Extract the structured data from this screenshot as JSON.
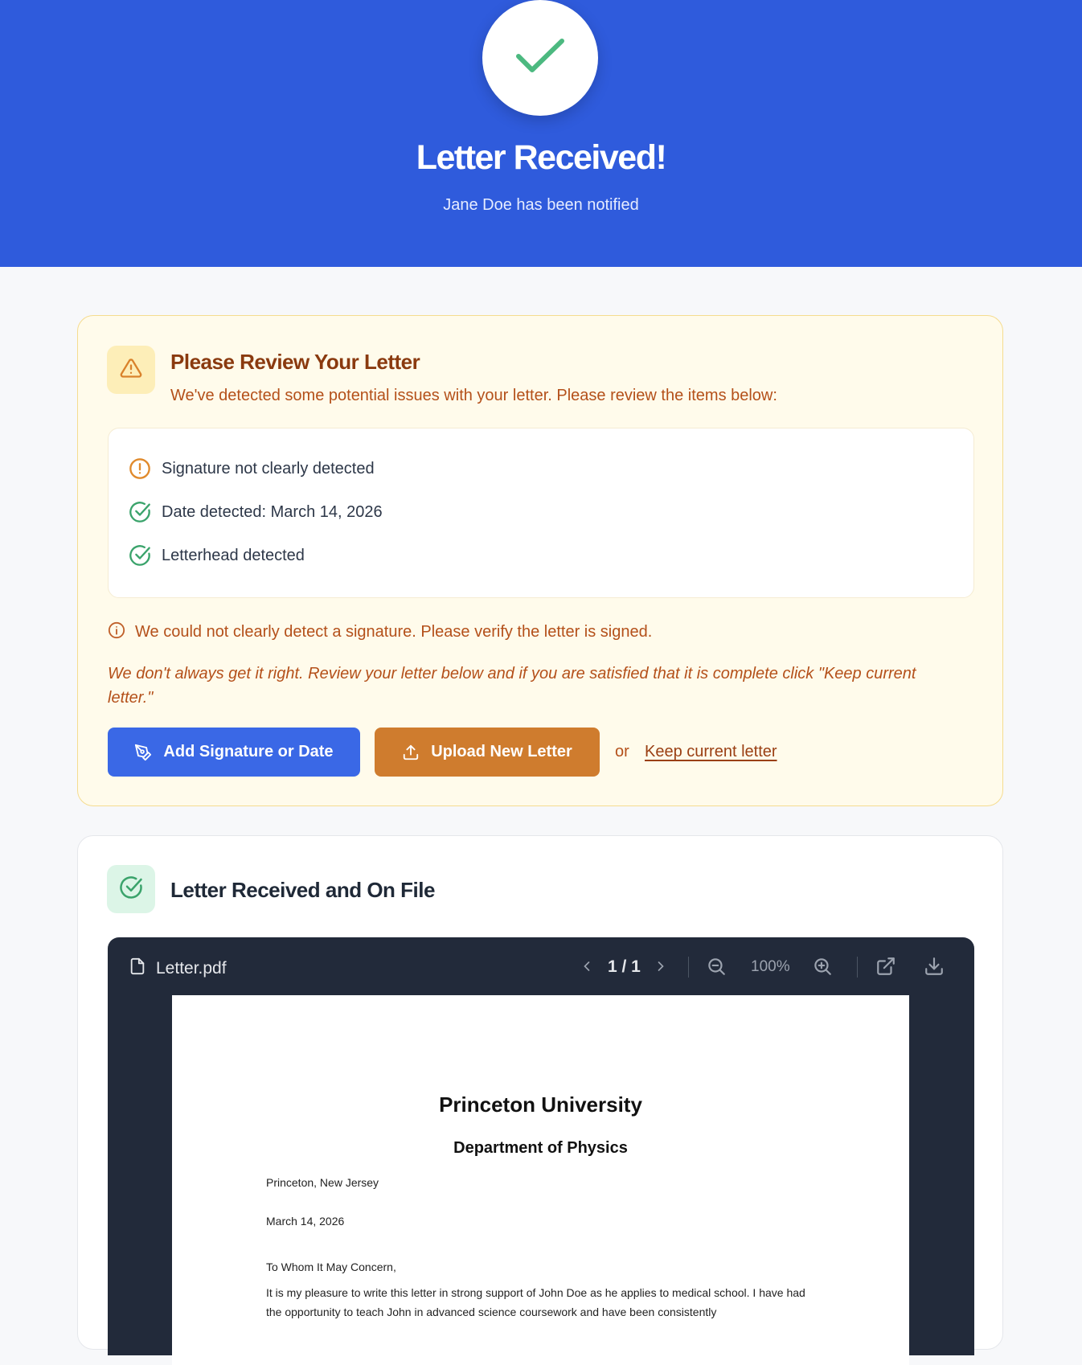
{
  "header": {
    "title": "Letter Received!",
    "subtitle": "Jane Doe has been notified",
    "icon": "check-icon",
    "accent": "#2f5bdc"
  },
  "review": {
    "title": "Please Review Your Letter",
    "description": "We've detected some potential issues with your letter. Please review the items below:",
    "checks": [
      {
        "label": "Signature not clearly detected",
        "status": "warning",
        "icon": "exclamation-circle-icon"
      },
      {
        "label": "Date detected: March 14, 2026",
        "status": "ok",
        "icon": "check-circle-icon"
      },
      {
        "label": "Letterhead detected",
        "status": "ok",
        "icon": "check-circle-icon"
      }
    ],
    "notice": "We could not clearly detect a signature. Please verify the letter is signed.",
    "disclaimer": "We don't always get it right. Review your letter below and if you are satisfied that it is complete click \"Keep current letter.\"",
    "add_signature_label": "Add Signature or Date",
    "upload_label": "Upload New Letter",
    "or_text": "or",
    "keep_label": "Keep current letter"
  },
  "on_file": {
    "title": "Letter Received and On File",
    "viewer": {
      "filename": "Letter.pdf",
      "page_indicator": "1 / 1",
      "zoom": "100%"
    },
    "document": {
      "university": "Princeton University",
      "department": "Department of Physics",
      "location": "Princeton, New Jersey",
      "date": "March 14, 2026",
      "salutation": "To Whom It May Concern,",
      "body": "It is my pleasure to write this letter in strong support of John Doe as he applies to medical school. I have had the opportunity to teach John in advanced science coursework and have been consistently"
    }
  },
  "colors": {
    "warning": "#e08a2c",
    "success": "#3aa36b",
    "primary_button": "#3a68e6",
    "secondary_button": "#cf7c2e"
  }
}
